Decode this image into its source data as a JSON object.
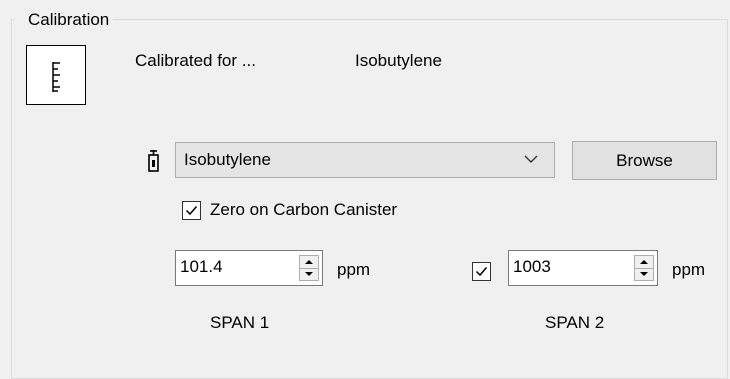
{
  "group": {
    "title": "Calibration"
  },
  "status": {
    "prefix": "Calibrated for ...",
    "gas": "Isobutylene"
  },
  "gas_select": {
    "value": "Isobutylene"
  },
  "browse": {
    "label": "Browse"
  },
  "zero": {
    "label": "Zero on Carbon Canister",
    "checked": true
  },
  "span1": {
    "value": "101.4",
    "unit": "ppm",
    "label": "SPAN 1"
  },
  "span2": {
    "value": "1003",
    "unit": "ppm",
    "label": "SPAN 2",
    "checked": true
  },
  "icons": [
    "calibration-ruler-icon",
    "gas-bottle-icon",
    "chevron-down-icon",
    "checkmark-icon",
    "spin-up-icon",
    "spin-down-icon"
  ]
}
